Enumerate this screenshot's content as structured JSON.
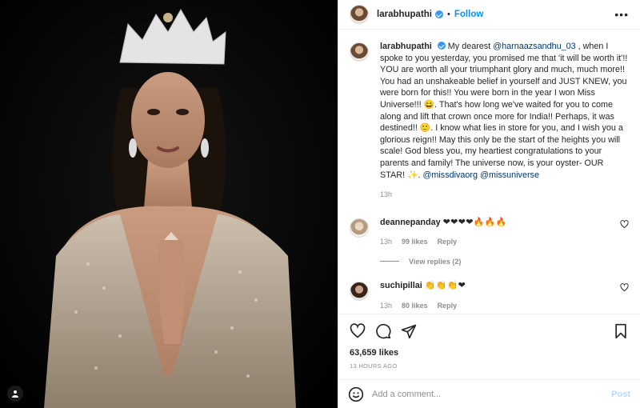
{
  "post": {
    "username": "larabhupathi",
    "follow_label": "Follow",
    "separator": "•",
    "more_label": "•••"
  },
  "caption": {
    "username": "larabhupathi",
    "text_1": "My dearest ",
    "mention_1": "@harnaazsandhu_03",
    "text_2": " , when I spoke to you yesterday, you promised me that 'it will be worth it'!! YOU are worth all your triumphant glory and much, much more!! You had an unshakeable belief in yourself and JUST KNEW, you were born for this!! You were born in the year I won Miss Universe!!! 😄. That's how long we've waited for you to come along and lift that crown once more for India!! Perhaps, it was destined!! 🙂. I know what lies in store for you, and I wish you a glorious reign!! May this only be the start of the heights you will scale! God bless you, my heartiest congratulations to your parents and family! The universe now, is your oyster- OUR STAR! ✨. ",
    "mention_2": "@missdivaorg",
    "mention_3": "@missuniverse",
    "time": "13h"
  },
  "comments": [
    {
      "username": "deannepanday",
      "text": "❤❤❤❤🔥🔥🔥",
      "time": "13h",
      "likes": "99 likes",
      "reply": "Reply"
    },
    {
      "username": "suchipillai",
      "text": "👏👏👏❤",
      "time": "13h",
      "likes": "80 likes",
      "reply": "Reply"
    }
  ],
  "view_replies": "View replies (2)",
  "likes_count": "63,659 likes",
  "posted_ago": "13 HOURS AGO",
  "add_comment": {
    "placeholder": "Add a comment...",
    "post_label": "Post"
  },
  "colors": {
    "link": "#0095f6",
    "mention": "#00376b",
    "muted": "#8e8e8e",
    "heart": "#e0245e"
  },
  "icons": [
    "heart-icon",
    "comment-icon",
    "share-icon",
    "save-icon",
    "emoji-icon",
    "user-tag-icon",
    "verified-icon"
  ]
}
